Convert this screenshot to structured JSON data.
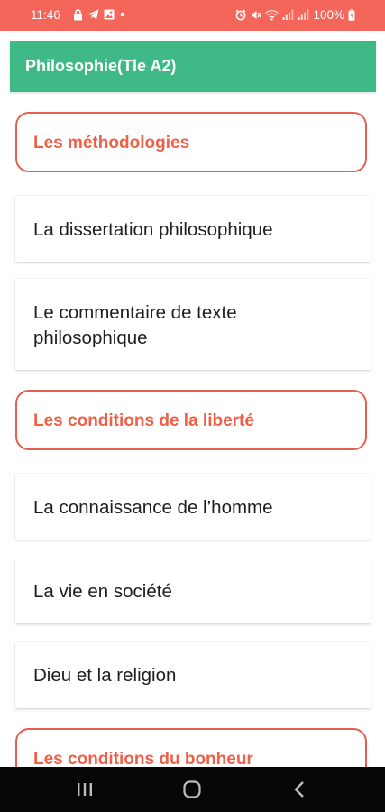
{
  "status_bar": {
    "time": "11:46",
    "battery": "100%",
    "background_color": "#f4655a",
    "left_icons": [
      "lock-icon",
      "telegram-icon",
      "image-icon",
      "dot-icon"
    ],
    "right_icons": [
      "alarm-icon",
      "mute-icon",
      "wifi-icon",
      "signal-icon",
      "signal-icon",
      "battery-icon"
    ]
  },
  "app_bar": {
    "title": "Philosophie(Tle A2)",
    "background_color": "#3fba87"
  },
  "accent_color": "#ee6048",
  "list": {
    "section_methodologies": "Les méthodologies",
    "item_dissertation": "La dissertation philosophique",
    "item_commentaire": "Le commentaire de texte philosophique",
    "section_liberte": "Les conditions de la liberté",
    "item_connaissance": "La connaissance de l’homme",
    "item_vie_societe": "La vie en société",
    "item_dieu_religion": "Dieu et la religion",
    "section_bonheur": "Les conditions du bonheur"
  },
  "nav_bar": {
    "buttons": [
      "recent-apps-icon",
      "home-icon",
      "back-icon"
    ]
  }
}
